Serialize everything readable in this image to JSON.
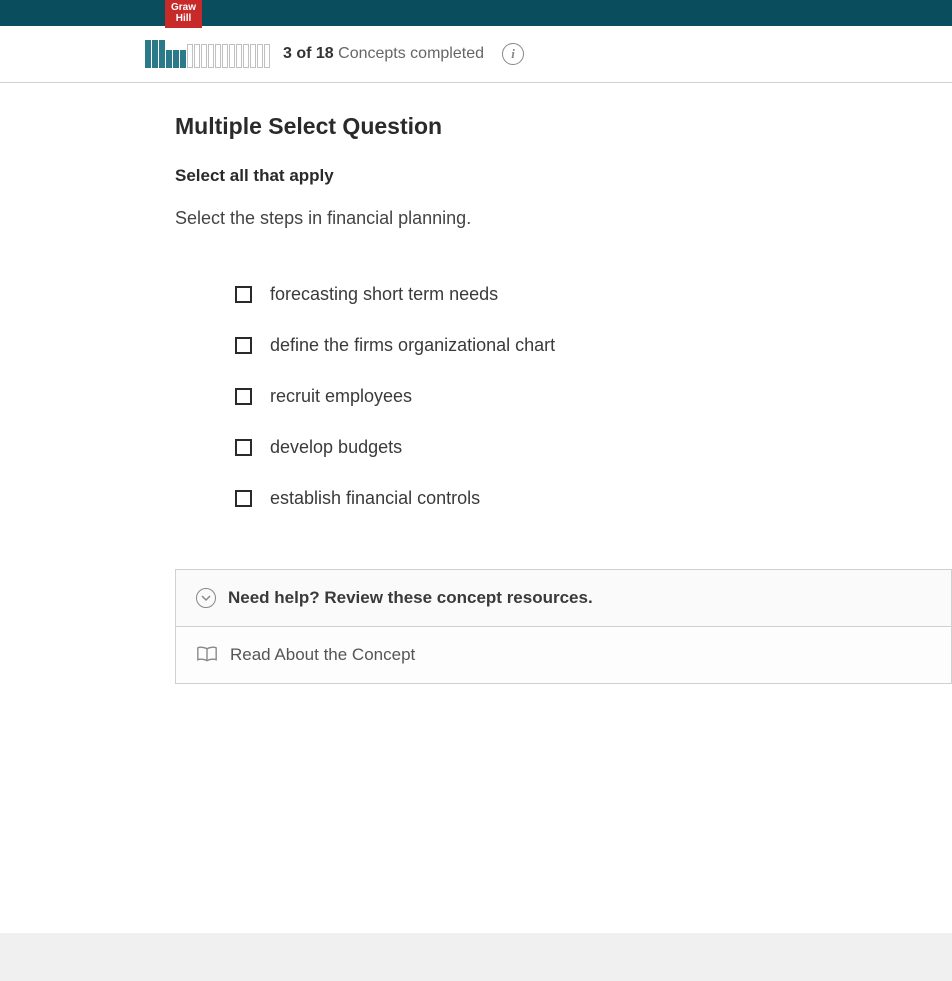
{
  "brand": {
    "line1": "Graw",
    "line2": "Hill"
  },
  "progress": {
    "completed": 3,
    "total": 18,
    "text_bold": "3 of 18",
    "text_rest": " Concepts completed"
  },
  "question": {
    "type": "Multiple Select Question",
    "instruction": "Select all that apply",
    "prompt": "Select the steps in financial planning."
  },
  "options": [
    {
      "label": "forecasting short term needs"
    },
    {
      "label": "define the firms organizational chart"
    },
    {
      "label": "recruit employees"
    },
    {
      "label": "develop budgets"
    },
    {
      "label": "establish financial controls"
    }
  ],
  "help": {
    "header": "Need help? Review these concept resources.",
    "resource": "Read About the Concept"
  }
}
